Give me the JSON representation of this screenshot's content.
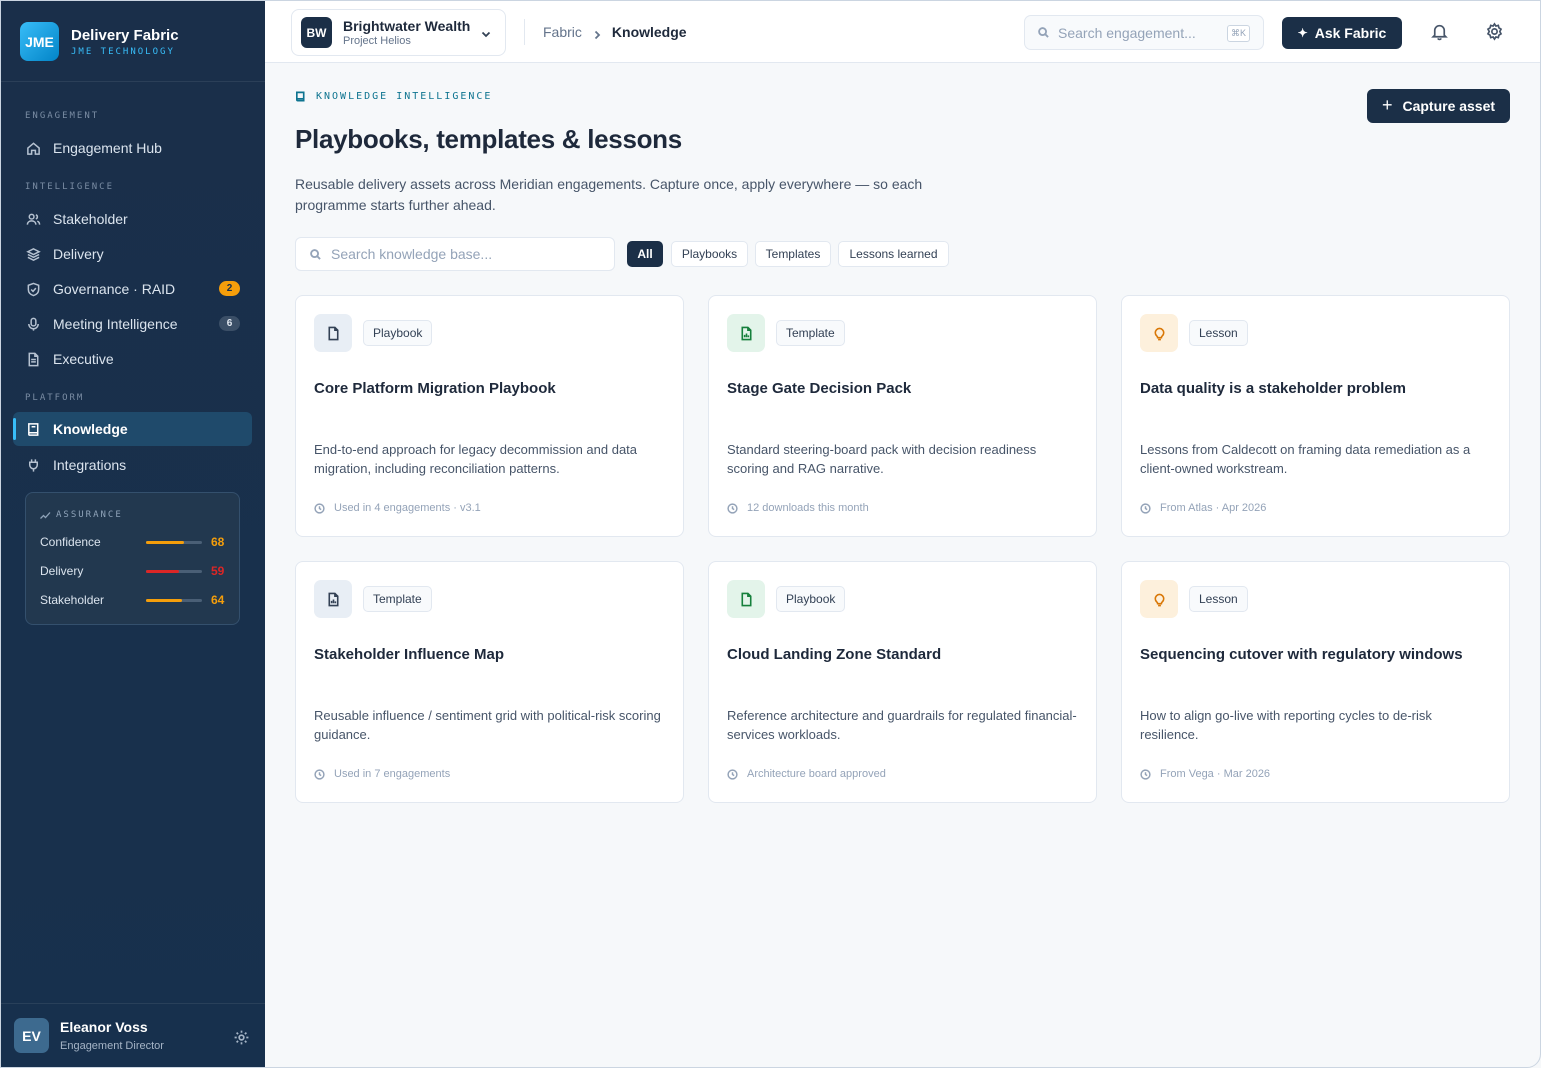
{
  "brand": {
    "logo": "JME",
    "title": "Delivery Fabric",
    "subtitle": "JME TECHNOLOGY"
  },
  "sidebar": {
    "sections": [
      {
        "label": "ENGAGEMENT"
      },
      {
        "label": "INTELLIGENCE"
      },
      {
        "label": "PLATFORM"
      }
    ],
    "items": [
      {
        "label": "Engagement Hub",
        "icon": "home-icon"
      },
      {
        "label": "Stakeholder",
        "icon": "users-icon"
      },
      {
        "label": "Delivery",
        "icon": "layers-icon"
      },
      {
        "label": "Governance · RAID",
        "icon": "shield-icon",
        "badge": "2"
      },
      {
        "label": "Meeting Intelligence",
        "icon": "mic-icon",
        "badge": "6"
      },
      {
        "label": "Executive",
        "icon": "file-text-icon"
      },
      {
        "label": "Knowledge",
        "icon": "book-icon",
        "active": true
      },
      {
        "label": "Integrations",
        "icon": "plug-icon"
      }
    ],
    "assurance": {
      "title": "ASSURANCE",
      "metrics": [
        {
          "label": "Confidence",
          "value": "68",
          "level": 0.68,
          "color": "#f59e0b"
        },
        {
          "label": "Delivery",
          "value": "59",
          "level": 0.59,
          "color": "#dc2626"
        },
        {
          "label": "Stakeholder",
          "value": "64",
          "level": 0.64,
          "color": "#f59e0b"
        }
      ]
    },
    "user": {
      "initials": "EV",
      "name": "Eleanor Voss",
      "role": "Engagement Director"
    }
  },
  "topbar": {
    "client": {
      "logo": "BW",
      "name": "Brightwater Wealth",
      "project": "Project Helios"
    },
    "breadcrumb": {
      "root": "Fabric",
      "current": "Knowledge"
    },
    "search": {
      "placeholder": "Search engagement...",
      "shortcut": "⌘K"
    },
    "ask_label": "Ask Fabric"
  },
  "main": {
    "eyebrow": "KNOWLEDGE INTELLIGENCE",
    "title": "Playbooks, templates & lessons",
    "description": "Reusable delivery assets across Meridian engagements. Capture once, apply everywhere — so each programme starts further ahead.",
    "capture_label": "Capture asset",
    "search_placeholder": "Search knowledge base...",
    "filters": [
      "All",
      "Playbooks",
      "Templates",
      "Lessons learned"
    ],
    "active_filter": "All",
    "cards": [
      {
        "tag": "Playbook",
        "kind": "playbook",
        "title": "Core Platform Migration Playbook",
        "description": "End-to-end approach for legacy decommission and data migration, including reconciliation patterns.",
        "footer": "Used in 4 engagements · v3.1"
      },
      {
        "tag": "Template",
        "kind": "template",
        "title": "Stage Gate Decision Pack",
        "description": "Standard steering-board pack with decision readiness scoring and RAG narrative.",
        "footer": "12 downloads this month"
      },
      {
        "tag": "Lesson",
        "kind": "lesson",
        "title": "Data quality is a stakeholder problem",
        "description": "Lessons from Caldecott on framing data remediation as a client-owned workstream.",
        "footer": "From Atlas · Apr 2026"
      },
      {
        "tag": "Template",
        "kind": "template",
        "title": "Stakeholder Influence Map",
        "description": "Reusable influence / sentiment grid with political-risk scoring guidance.",
        "footer": "Used in 7 engagements"
      },
      {
        "tag": "Playbook",
        "kind": "playbook",
        "title": "Cloud Landing Zone Standard",
        "description": "Reference architecture and guardrails for regulated financial-services workloads.",
        "footer": "Architecture board approved"
      },
      {
        "tag": "Lesson",
        "kind": "lesson",
        "title": "Sequencing cutover with regulatory windows",
        "description": "How to align go-live with reporting cycles to de-risk resilience.",
        "footer": "From Vega · Mar 2026"
      }
    ]
  }
}
